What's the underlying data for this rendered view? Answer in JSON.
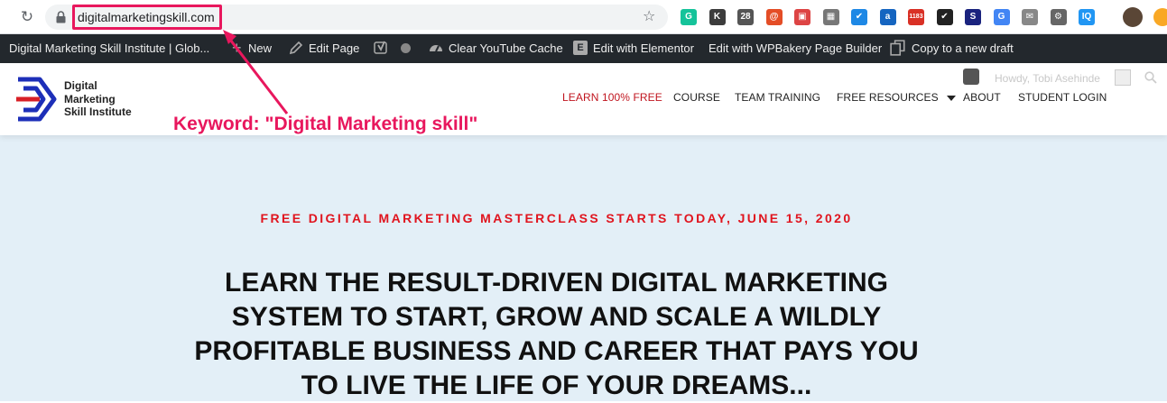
{
  "browser": {
    "url": "digitalmarketingskill.com",
    "extensions": [
      {
        "name": "grammarly-icon",
        "color": "#15c39a",
        "glyph": "G"
      },
      {
        "name": "k-extension-icon",
        "color": "#3c3c3c",
        "glyph": "K"
      },
      {
        "name": "calendar-extension-icon",
        "color": "#555555",
        "glyph": "28"
      },
      {
        "name": "spiral-extension-icon",
        "color": "#e44d26",
        "glyph": "@"
      },
      {
        "name": "window-extension-icon",
        "color": "#d44",
        "glyph": "▣"
      },
      {
        "name": "screenshot-extension-icon",
        "color": "#777777",
        "glyph": "▦"
      },
      {
        "name": "check-blue-extension-icon",
        "color": "#1e88e5",
        "glyph": "✔"
      },
      {
        "name": "a-extension-icon",
        "color": "#1565c0",
        "glyph": "a"
      },
      {
        "name": "gmail-extension-icon",
        "color": "#d93025",
        "glyph": "1183"
      },
      {
        "name": "checkbox-extension-icon",
        "color": "#222222",
        "glyph": "✔"
      },
      {
        "name": "s-extension-icon",
        "color": "#1a237e",
        "glyph": "S"
      },
      {
        "name": "google-extension-icon",
        "color": "#4285f4",
        "glyph": "G"
      },
      {
        "name": "mail-extension-icon",
        "color": "#888888",
        "glyph": "✉"
      },
      {
        "name": "gear-extension-icon",
        "color": "#666666",
        "glyph": "⚙"
      },
      {
        "name": "iq-extension-icon",
        "color": "#2196f3",
        "glyph": "IQ"
      }
    ]
  },
  "adminbar": {
    "site_name": "Digital Marketing Skill Institute | Glob...",
    "new_label": "New",
    "edit_page_label": "Edit Page",
    "clear_cache_label": "Clear YouTube Cache",
    "elementor_label": "Edit with Elementor",
    "wpbakery_label": "Edit with WPBakery Page Builder",
    "copy_draft_label": "Copy to a new draft"
  },
  "header": {
    "logo_lines": [
      "Digital",
      "Marketing",
      "Skill Institute"
    ],
    "howdy": "Howdy, Tobi Asehinde",
    "menu": [
      {
        "label": "LEARN 100% FREE",
        "active": true
      },
      {
        "label": "COURSE"
      },
      {
        "label": "TEAM TRAINING"
      },
      {
        "label": "FREE RESOURCES"
      },
      {
        "label": "ABOUT"
      },
      {
        "label": "STUDENT LOGIN"
      }
    ]
  },
  "annotation": {
    "text": "Keyword: \"Digital Marketing skill\""
  },
  "hero": {
    "kicker": "FREE DIGITAL MARKETING MASTERCLASS STARTS TODAY, JUNE 15, 2020",
    "title_lines": [
      "LEARN THE RESULT-DRIVEN DIGITAL MARKETING",
      "SYSTEM TO START, GROW AND SCALE A WILDLY",
      "PROFITABLE BUSINESS AND CAREER THAT PAYS YOU",
      "TO LIVE THE LIFE OF YOUR DREAMS..."
    ]
  },
  "colors": {
    "accent_red": "#e0141e",
    "annotation_pink": "#e8175d",
    "hero_bg": "#e3eff7",
    "adminbar_bg": "#23282d"
  }
}
